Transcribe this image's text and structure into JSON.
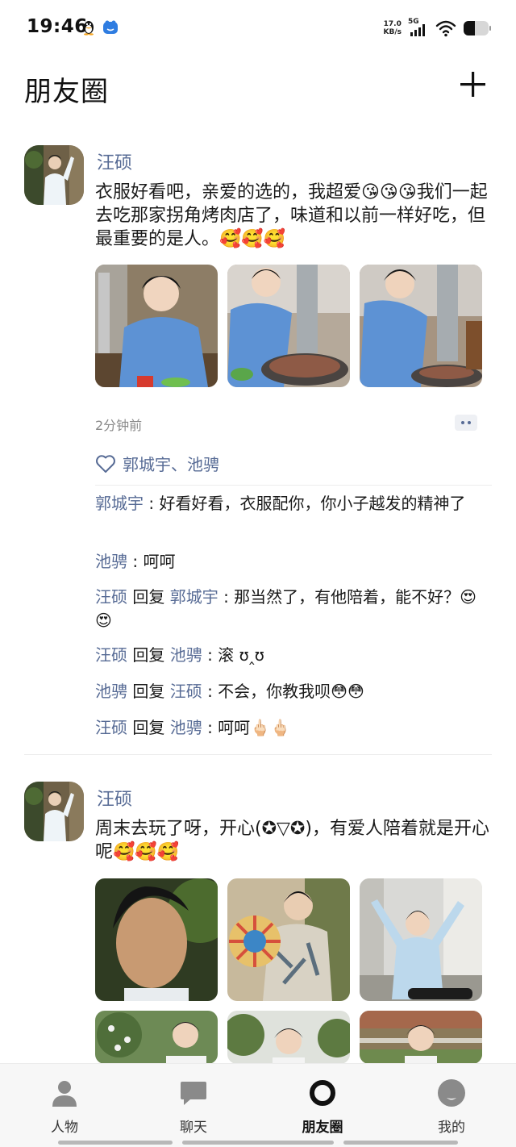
{
  "status_bar": {
    "time": "19:46",
    "net_speed_value": "17.0",
    "net_speed_unit": "KB/s",
    "signal_label": "5G",
    "icons": [
      "penguin-icon",
      "cloud-app-icon",
      "signal-icon",
      "wifi-icon",
      "battery-icon"
    ]
  },
  "header": {
    "title": "朋友圈",
    "add_icon": "plus-icon"
  },
  "posts": [
    {
      "author": "汪硕",
      "text": "衣服好看吧，亲爱的选的，我超爱😘😘😘我们一起去吃那家拐角烤肉店了，味道和以前一样好吃，但最重要的是人。🥰🥰🥰",
      "photos": [
        "blue-shirt-portrait",
        "grilling-meat",
        "bbq-table"
      ],
      "time_ago": "2分钟前",
      "likes": "郭城宇、池骋",
      "comments": [
        {
          "from": "郭城宇",
          "reply_word": "",
          "to": "",
          "sep": " : ",
          "text": "好看好看，衣服配你，你小子越发的精神了"
        },
        {
          "from": "池骋",
          "reply_word": "",
          "to": "",
          "sep": " : ",
          "text": "呵呵"
        },
        {
          "from": "汪硕",
          "reply_word": " 回复 ",
          "to": "郭城宇",
          "sep": " : ",
          "text": "那当然了，有他陪着，能不好？😍😍"
        },
        {
          "from": "汪硕",
          "reply_word": " 回复 ",
          "to": "池骋",
          "sep": " : ",
          "text": "滚 ʊ‸ʊ"
        },
        {
          "from": "池骋",
          "reply_word": " 回复 ",
          "to": "汪硕",
          "sep": " : ",
          "text": "不会，你教我呗😳😳"
        },
        {
          "from": "汪硕",
          "reply_word": " 回复 ",
          "to": "池骋",
          "sep": " : ",
          "text": "呵呵🖕🏻🖕🏻"
        }
      ]
    },
    {
      "author": "汪硕",
      "text": "周末去玩了呀，开心(✪▽✪)，有爱人陪着就是开心呢🥰🥰🥰",
      "photos": [
        "face-closeup",
        "pinwheel",
        "arms-raised",
        "garden-flowers",
        "trees",
        "garden-fence"
      ]
    }
  ],
  "tab_bar": {
    "tabs": [
      {
        "label": "人物",
        "icon": "person-icon",
        "active": false
      },
      {
        "label": "聊天",
        "icon": "chat-bubble-icon",
        "active": false
      },
      {
        "label": "朋友圈",
        "icon": "moments-ring-icon",
        "active": true
      },
      {
        "label": "我的",
        "icon": "profile-face-icon",
        "active": false
      }
    ]
  }
}
